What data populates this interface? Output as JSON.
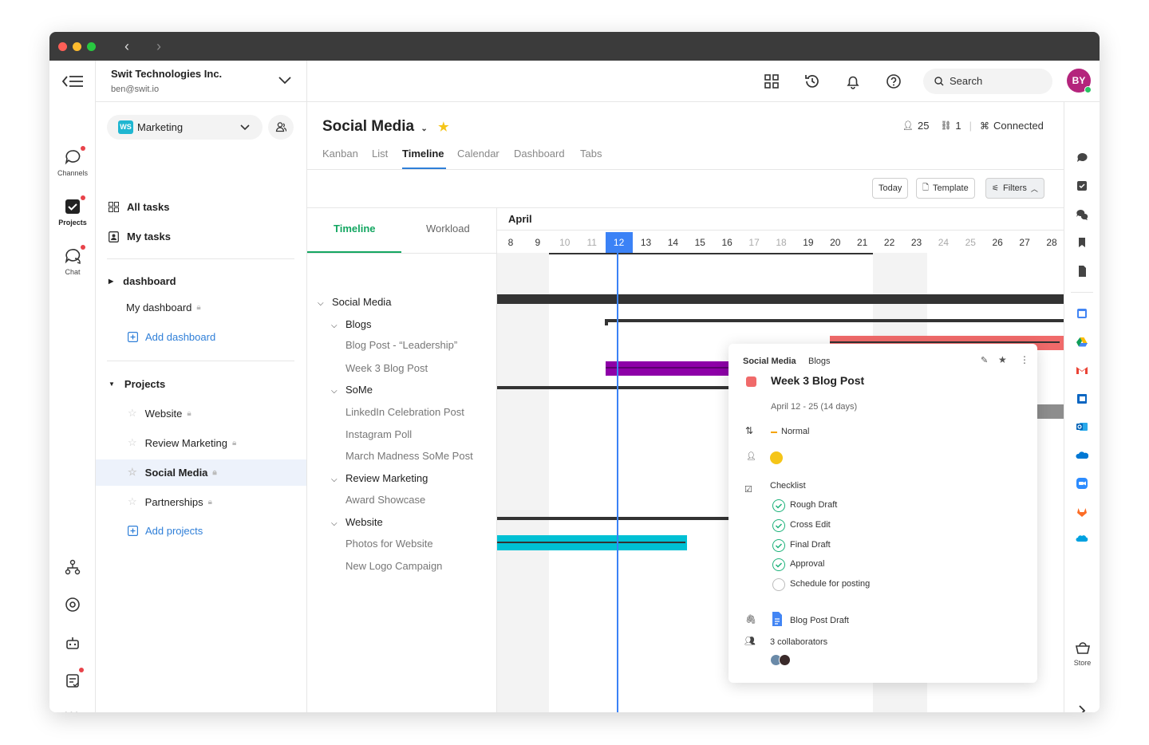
{
  "workspace": {
    "name": "Swit Technologies Inc.",
    "email": "ben@swit.io"
  },
  "rail": {
    "channels": "Channels",
    "projects": "Projects",
    "chat": "Chat"
  },
  "sidebar": {
    "ws_badge": "WS",
    "ws_name": "Marketing",
    "all_tasks": "All tasks",
    "my_tasks": "My tasks",
    "dashboard_group": "dashboard",
    "my_dashboard": "My dashboard",
    "add_dashboard": "Add dashboard",
    "projects_group": "Projects",
    "projects": [
      {
        "label": "Website"
      },
      {
        "label": "Review Marketing"
      },
      {
        "label": "Social Media"
      },
      {
        "label": "Partnerships"
      }
    ],
    "add_projects": "Add projects"
  },
  "topbar": {
    "search_placeholder": "Search",
    "avatar_initials": "BY"
  },
  "project": {
    "title": "Social Media",
    "members_count": "25",
    "links_count": "1",
    "connected": "Connected",
    "tabs": [
      "Kanban",
      "List",
      "Timeline",
      "Calendar",
      "Dashboard",
      "Tabs"
    ],
    "active_tab": "Timeline"
  },
  "toolbar": {
    "today": "Today",
    "template": "Template",
    "filters": "Filters"
  },
  "tree": {
    "tab_timeline": "Timeline",
    "tab_workload": "Workload",
    "items": [
      {
        "label": "Social Media"
      },
      {
        "label": "Blogs"
      },
      {
        "label": "Blog Post - “Leadership”"
      },
      {
        "label": "Week 3 Blog Post"
      },
      {
        "label": "SoMe"
      },
      {
        "label": "LinkedIn Celebration Post"
      },
      {
        "label": "Instagram Poll"
      },
      {
        "label": "March Madness SoMe Post"
      },
      {
        "label": "Review Marketing"
      },
      {
        "label": "Award Showcase"
      },
      {
        "label": "Website"
      },
      {
        "label": "Photos for Website"
      },
      {
        "label": "New Logo Campaign"
      }
    ]
  },
  "gantt": {
    "month": "April",
    "days": [
      "8",
      "9",
      "10",
      "11",
      "12",
      "13",
      "14",
      "15",
      "16",
      "17",
      "18",
      "19",
      "20",
      "21",
      "22",
      "23",
      "24",
      "25",
      "26",
      "27",
      "28"
    ],
    "today": "12",
    "colors": {
      "today": "#3b82f6",
      "pink": "#f06a6a",
      "purple": "#8e00a8",
      "cyan": "#00c0d4",
      "dark": "#333333"
    }
  },
  "popup": {
    "crumb_project": "Social Media",
    "crumb_list": "Blogs",
    "title": "Week 3 Blog Post",
    "dates": "April 12 - 25 (14 days)",
    "priority": "Normal",
    "checklist_label": "Checklist",
    "checklist": [
      {
        "label": "Rough Draft",
        "done": true
      },
      {
        "label": "Cross Edit",
        "done": true
      },
      {
        "label": "Final Draft",
        "done": true
      },
      {
        "label": "Approval",
        "done": true
      },
      {
        "label": "Schedule for posting",
        "done": false
      }
    ],
    "attachment": "Blog Post Draft",
    "collaborators": "3 collaborators"
  },
  "right_rail": {
    "store": "Store"
  }
}
